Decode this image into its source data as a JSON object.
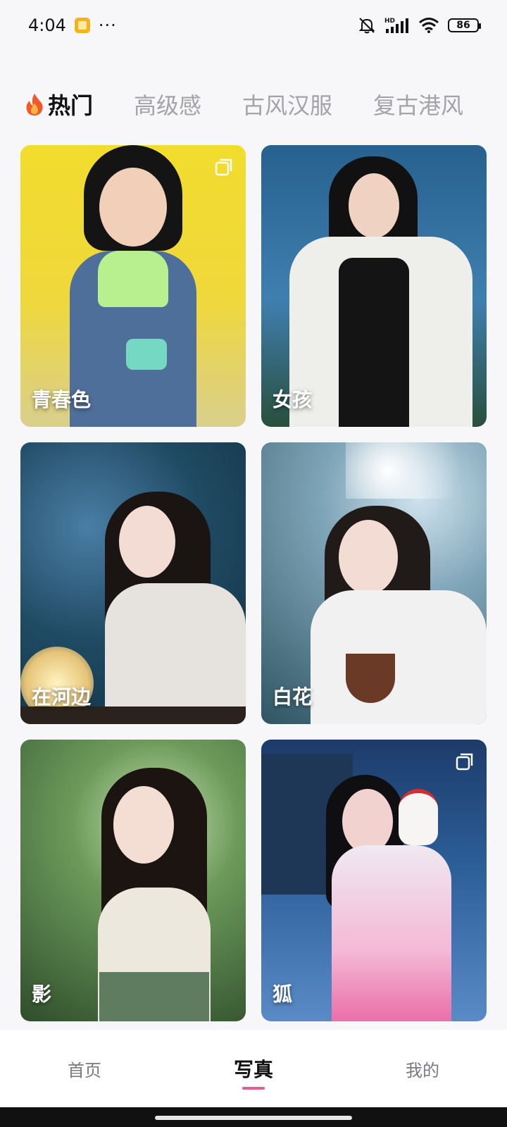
{
  "status_bar": {
    "time": "4:04",
    "dots": "···",
    "battery": "86",
    "icons": [
      "mute-icon",
      "hd-signal-icon",
      "wifi-icon",
      "battery-icon"
    ]
  },
  "tabs": [
    {
      "label": "热门",
      "active": true,
      "icon": "fire-icon"
    },
    {
      "label": "高级感",
      "active": false
    },
    {
      "label": "古风汉服",
      "active": false
    },
    {
      "label": "复古港风",
      "active": false
    }
  ],
  "cards": [
    {
      "label": "青春色",
      "has_copy_icon": true
    },
    {
      "label": "女孩",
      "has_copy_icon": false
    },
    {
      "label": "在河边",
      "has_copy_icon": false
    },
    {
      "label": "白花",
      "has_copy_icon": false
    },
    {
      "label": "影",
      "has_copy_icon": false
    },
    {
      "label": "狐",
      "has_copy_icon": true
    }
  ],
  "bottom_nav": [
    {
      "label": "首页",
      "active": false
    },
    {
      "label": "写真",
      "active": true
    },
    {
      "label": "我的",
      "active": false
    }
  ],
  "colors": {
    "accent": "#e05f8e",
    "tab_inactive": "#a3a3a8",
    "background": "#f7f7f9"
  }
}
